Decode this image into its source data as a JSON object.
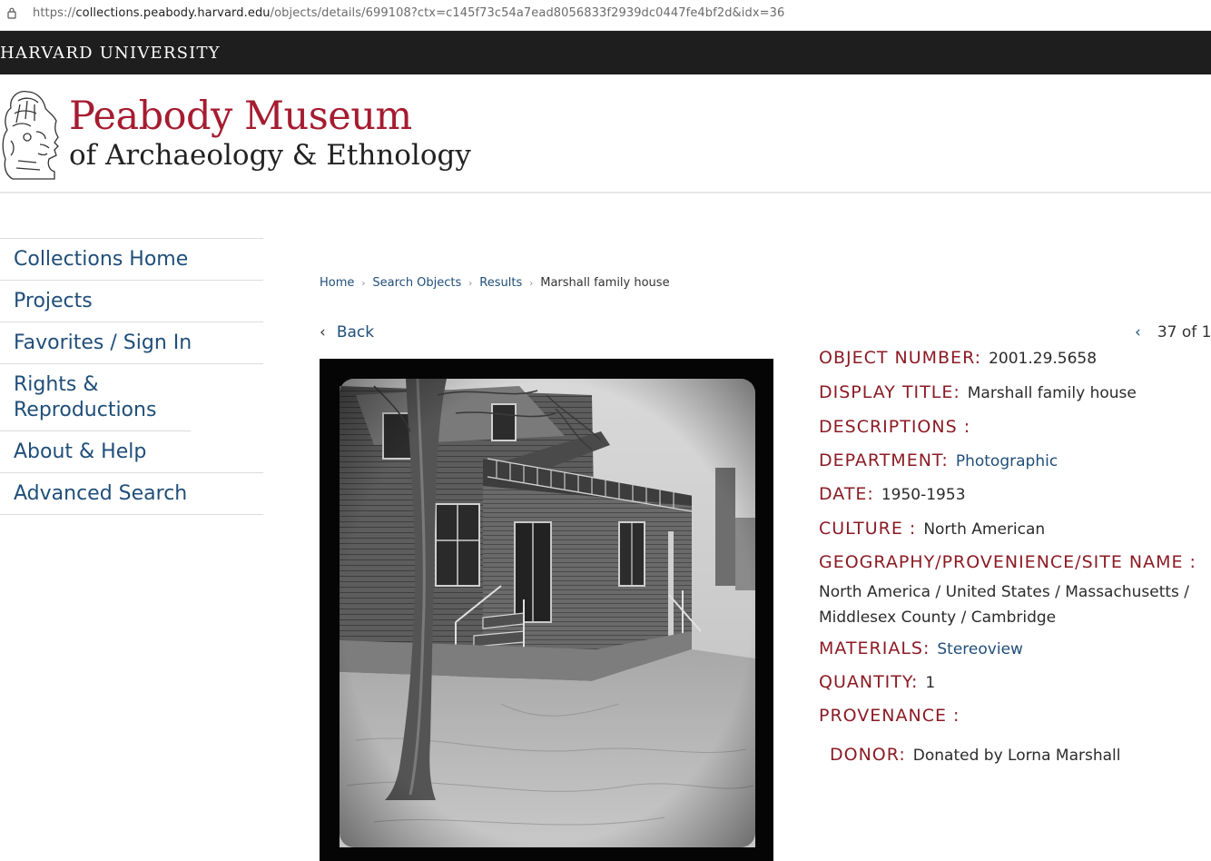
{
  "browser": {
    "url_prefix": "https://",
    "url_host": "collections.peabody.harvard.edu",
    "url_path": "/objects/details/699108?ctx=c145f73c54a7ead8056833f2939dc0447fe4bf2d&idx=36"
  },
  "harvard_bar": {
    "title": "HARVARD UNIVERSITY"
  },
  "header": {
    "name_line1": "Peabody Museum",
    "name_line2": "of Archaeology & Ethnology"
  },
  "sidebar": {
    "items": [
      {
        "label": "Collections Home"
      },
      {
        "label": "Projects"
      },
      {
        "label": "Favorites / Sign In"
      },
      {
        "label": "Rights & Reproductions"
      },
      {
        "label": "About & Help"
      },
      {
        "label": "Advanced Search"
      }
    ]
  },
  "breadcrumb": {
    "items": [
      "Home",
      "Search Objects",
      "Results"
    ],
    "current": "Marshall family house"
  },
  "nav": {
    "back_label": "Back",
    "chevron_left": "‹",
    "pager_text": "37 of 1"
  },
  "object": {
    "object_number_label": "OBJECT NUMBER:",
    "object_number": "2001.29.5658",
    "display_title_label": "DISPLAY TITLE:",
    "display_title": "Marshall family house",
    "descriptions_label": "DESCRIPTIONS :",
    "department_label": "DEPARTMENT:",
    "department": "Photographic",
    "date_label": "DATE:",
    "date": "1950-1953",
    "culture_label": "CULTURE :",
    "culture": "North American",
    "geography_label": "GEOGRAPHY/PROVENIENCE/SITE NAME :",
    "geography": "North America / United States / Massachusetts / Middlesex County / Cambridge",
    "materials_label": "MATERIALS:",
    "materials": "Stereoview",
    "quantity_label": "QUANTITY:",
    "quantity": "1",
    "provenance_label": "PROVENANCE :",
    "donor_label": "DONOR:",
    "donor": "Donated by Lorna Marshall"
  },
  "colors": {
    "brand_red": "#a51c30",
    "label_red": "#8b1b24",
    "link_blue": "#1f4e79",
    "harvard_bar": "#1e1e1e"
  },
  "icons": [
    "lock-icon",
    "museum-logo",
    "chevron-left-icon"
  ]
}
